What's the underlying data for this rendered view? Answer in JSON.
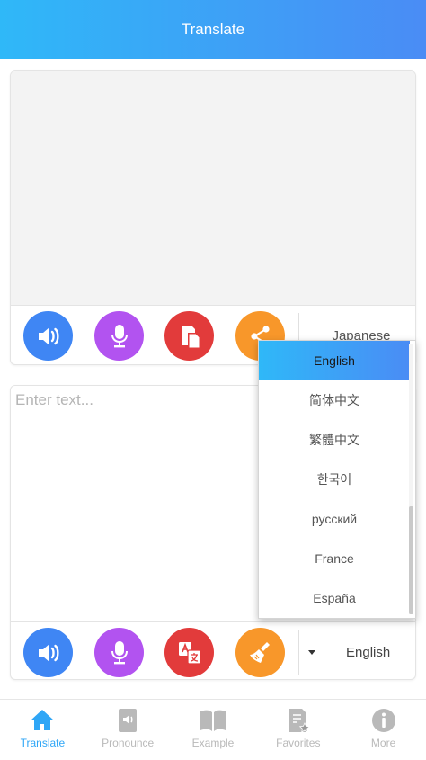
{
  "header": {
    "title": "Translate"
  },
  "top_panel": {
    "output_text": "",
    "target_language": "Japanese",
    "buttons": {
      "speak": "speaker-icon",
      "mic": "microphone-icon",
      "copy": "copy-icon",
      "share": "share-icon"
    }
  },
  "bottom_panel": {
    "input_placeholder": "Enter text...",
    "input_value": "",
    "source_language": "English",
    "buttons": {
      "speak": "speaker-icon",
      "mic": "microphone-icon",
      "translate": "translate-icon",
      "clear": "broom-icon"
    }
  },
  "language_dropdown": {
    "selected": "English",
    "options": [
      "English",
      "简体中文",
      "繁體中文",
      "한국어",
      "русский",
      "France",
      "España"
    ]
  },
  "bottom_nav": {
    "items": [
      {
        "label": "Translate",
        "icon": "home-icon",
        "active": true
      },
      {
        "label": "Pronounce",
        "icon": "pronounce-icon",
        "active": false
      },
      {
        "label": "Example",
        "icon": "book-icon",
        "active": false
      },
      {
        "label": "Favorites",
        "icon": "favorites-icon",
        "active": false
      },
      {
        "label": "More",
        "icon": "info-icon",
        "active": false
      }
    ]
  },
  "colors": {
    "header_gradient_start": "#2fb8f8",
    "header_gradient_end": "#4a8cf5",
    "speak_button": "#3f86f4",
    "mic_button": "#b253f0",
    "copy_button": "#e23b3b",
    "share_button": "#f8972a",
    "nav_active": "#2fa6f6",
    "nav_inactive": "#b9b9b9"
  }
}
